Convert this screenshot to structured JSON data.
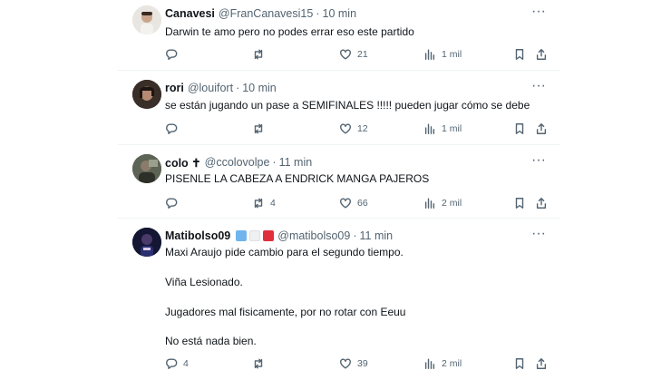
{
  "tweets": [
    {
      "name": "Canavesi",
      "handle": "@FranCanavesi15",
      "time": "10 min",
      "text": [
        "Darwin te amo pero no podes errar eso este partido"
      ],
      "reply": "",
      "retweet": "",
      "like": "21",
      "views": "1 mil"
    },
    {
      "name": "rori",
      "handle": "@louifort",
      "time": "10 min",
      "text": [
        "se están jugando un pase a SEMIFINALES !!!!! pueden jugar cómo se debe"
      ],
      "reply": "",
      "retweet": "",
      "like": "12",
      "views": "1 mil"
    },
    {
      "name": "colo ✝",
      "handle": "@ccolovolpe",
      "time": "11 min",
      "text": [
        "PISENLE LA CABEZA A ENDRICK MANGA PAJEROS"
      ],
      "reply": "",
      "retweet": "4",
      "like": "66",
      "views": "2 mil"
    },
    {
      "name": "Matibolso09",
      "handle": "@matibolso09",
      "time": "11 min",
      "text": [
        "Maxi Araujo pide cambio para el segundo tiempo.",
        "Viña Lesionado.",
        "Jugadores mal fisicamente, por no rotar con Eeuu",
        "No está nada bien."
      ],
      "reply": "4",
      "retweet": "",
      "like": "39",
      "views": "2 mil",
      "flag_colors": [
        "#6fb4ec",
        "#eef0f2",
        "#e0303c"
      ]
    }
  ],
  "separator": "·",
  "more_label": "···"
}
